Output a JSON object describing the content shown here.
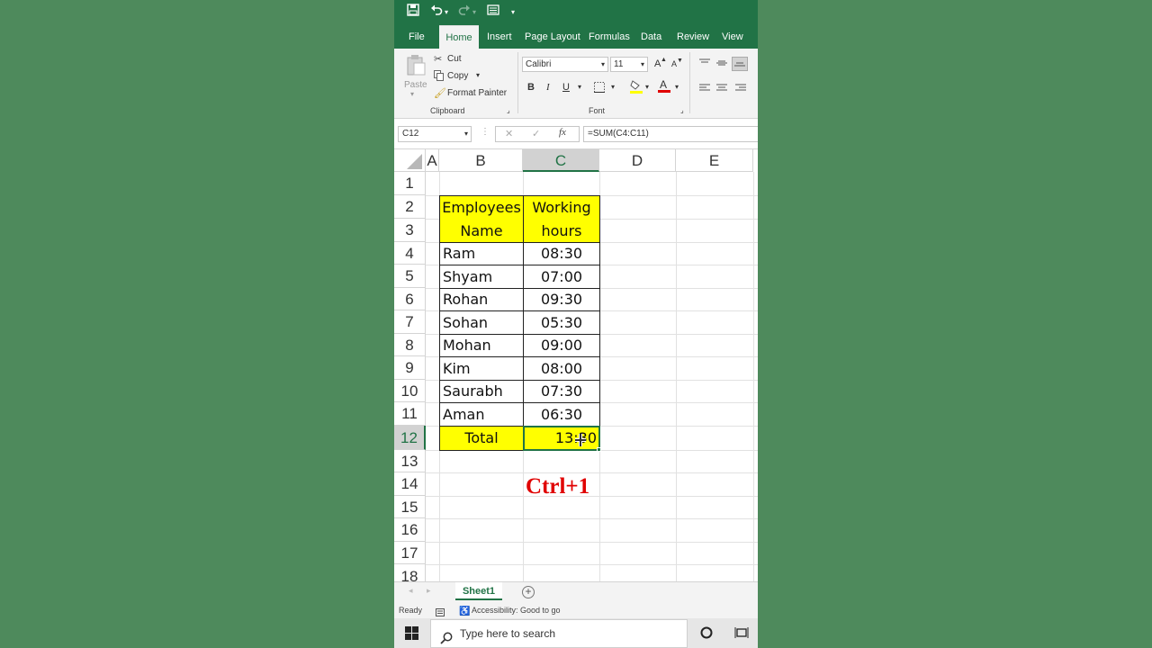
{
  "qat": {
    "save_icon": "save-icon",
    "undo_icon": "undo-icon",
    "redo_icon": "redo-icon",
    "form_icon": "form-icon",
    "more_icon": "customize-icon"
  },
  "tabs": [
    "File",
    "Home",
    "Insert",
    "Page Layout",
    "Formulas",
    "Data",
    "Review",
    "View"
  ],
  "ribbon": {
    "paste": "Paste",
    "cut": "Cut",
    "copy": "Copy",
    "format_painter": "Format Painter",
    "clipboard_label": "Clipboard",
    "font_name": "Calibri",
    "font_size": "11",
    "grow": "A",
    "shrink": "A",
    "bold": "B",
    "italic": "I",
    "underline": "U",
    "font_label": "Font"
  },
  "formula_bar": {
    "name_box": "C12",
    "cancel": "✕",
    "enter": "✓",
    "fx": "fx",
    "formula": "=SUM(C4:C11)"
  },
  "columns": [
    "A",
    "B",
    "C",
    "D",
    "E"
  ],
  "rows": [
    "1",
    "2",
    "3",
    "4",
    "5",
    "6",
    "7",
    "8",
    "9",
    "10",
    "11",
    "12",
    "13",
    "14",
    "15",
    "16",
    "17",
    "18"
  ],
  "table": {
    "header_name": [
      "Employees",
      "Name"
    ],
    "header_hours": [
      "Working",
      "hours"
    ],
    "employees": [
      {
        "name": "Ram",
        "hours": "08:30"
      },
      {
        "name": "Shyam",
        "hours": "07:00"
      },
      {
        "name": "Rohan",
        "hours": "09:30"
      },
      {
        "name": "Sohan",
        "hours": "05:30"
      },
      {
        "name": "Mohan",
        "hours": "09:00"
      },
      {
        "name": "Kim",
        "hours": "08:00"
      },
      {
        "name": "Saurabh",
        "hours": "07:30"
      },
      {
        "name": "Aman",
        "hours": "06:30"
      }
    ],
    "total_label": "Total",
    "total_value": "13:30"
  },
  "overlay": {
    "shortcut": "Ctrl+1"
  },
  "sheets": {
    "active": "Sheet1",
    "add": "+"
  },
  "status": {
    "ready": "Ready",
    "accessibility": "Accessibility: Good to go"
  },
  "taskbar": {
    "search_placeholder": "Type here to search"
  },
  "colors": {
    "excel_green": "#217346",
    "highlight": "#ffff00",
    "shortcut_red": "#e00000"
  }
}
